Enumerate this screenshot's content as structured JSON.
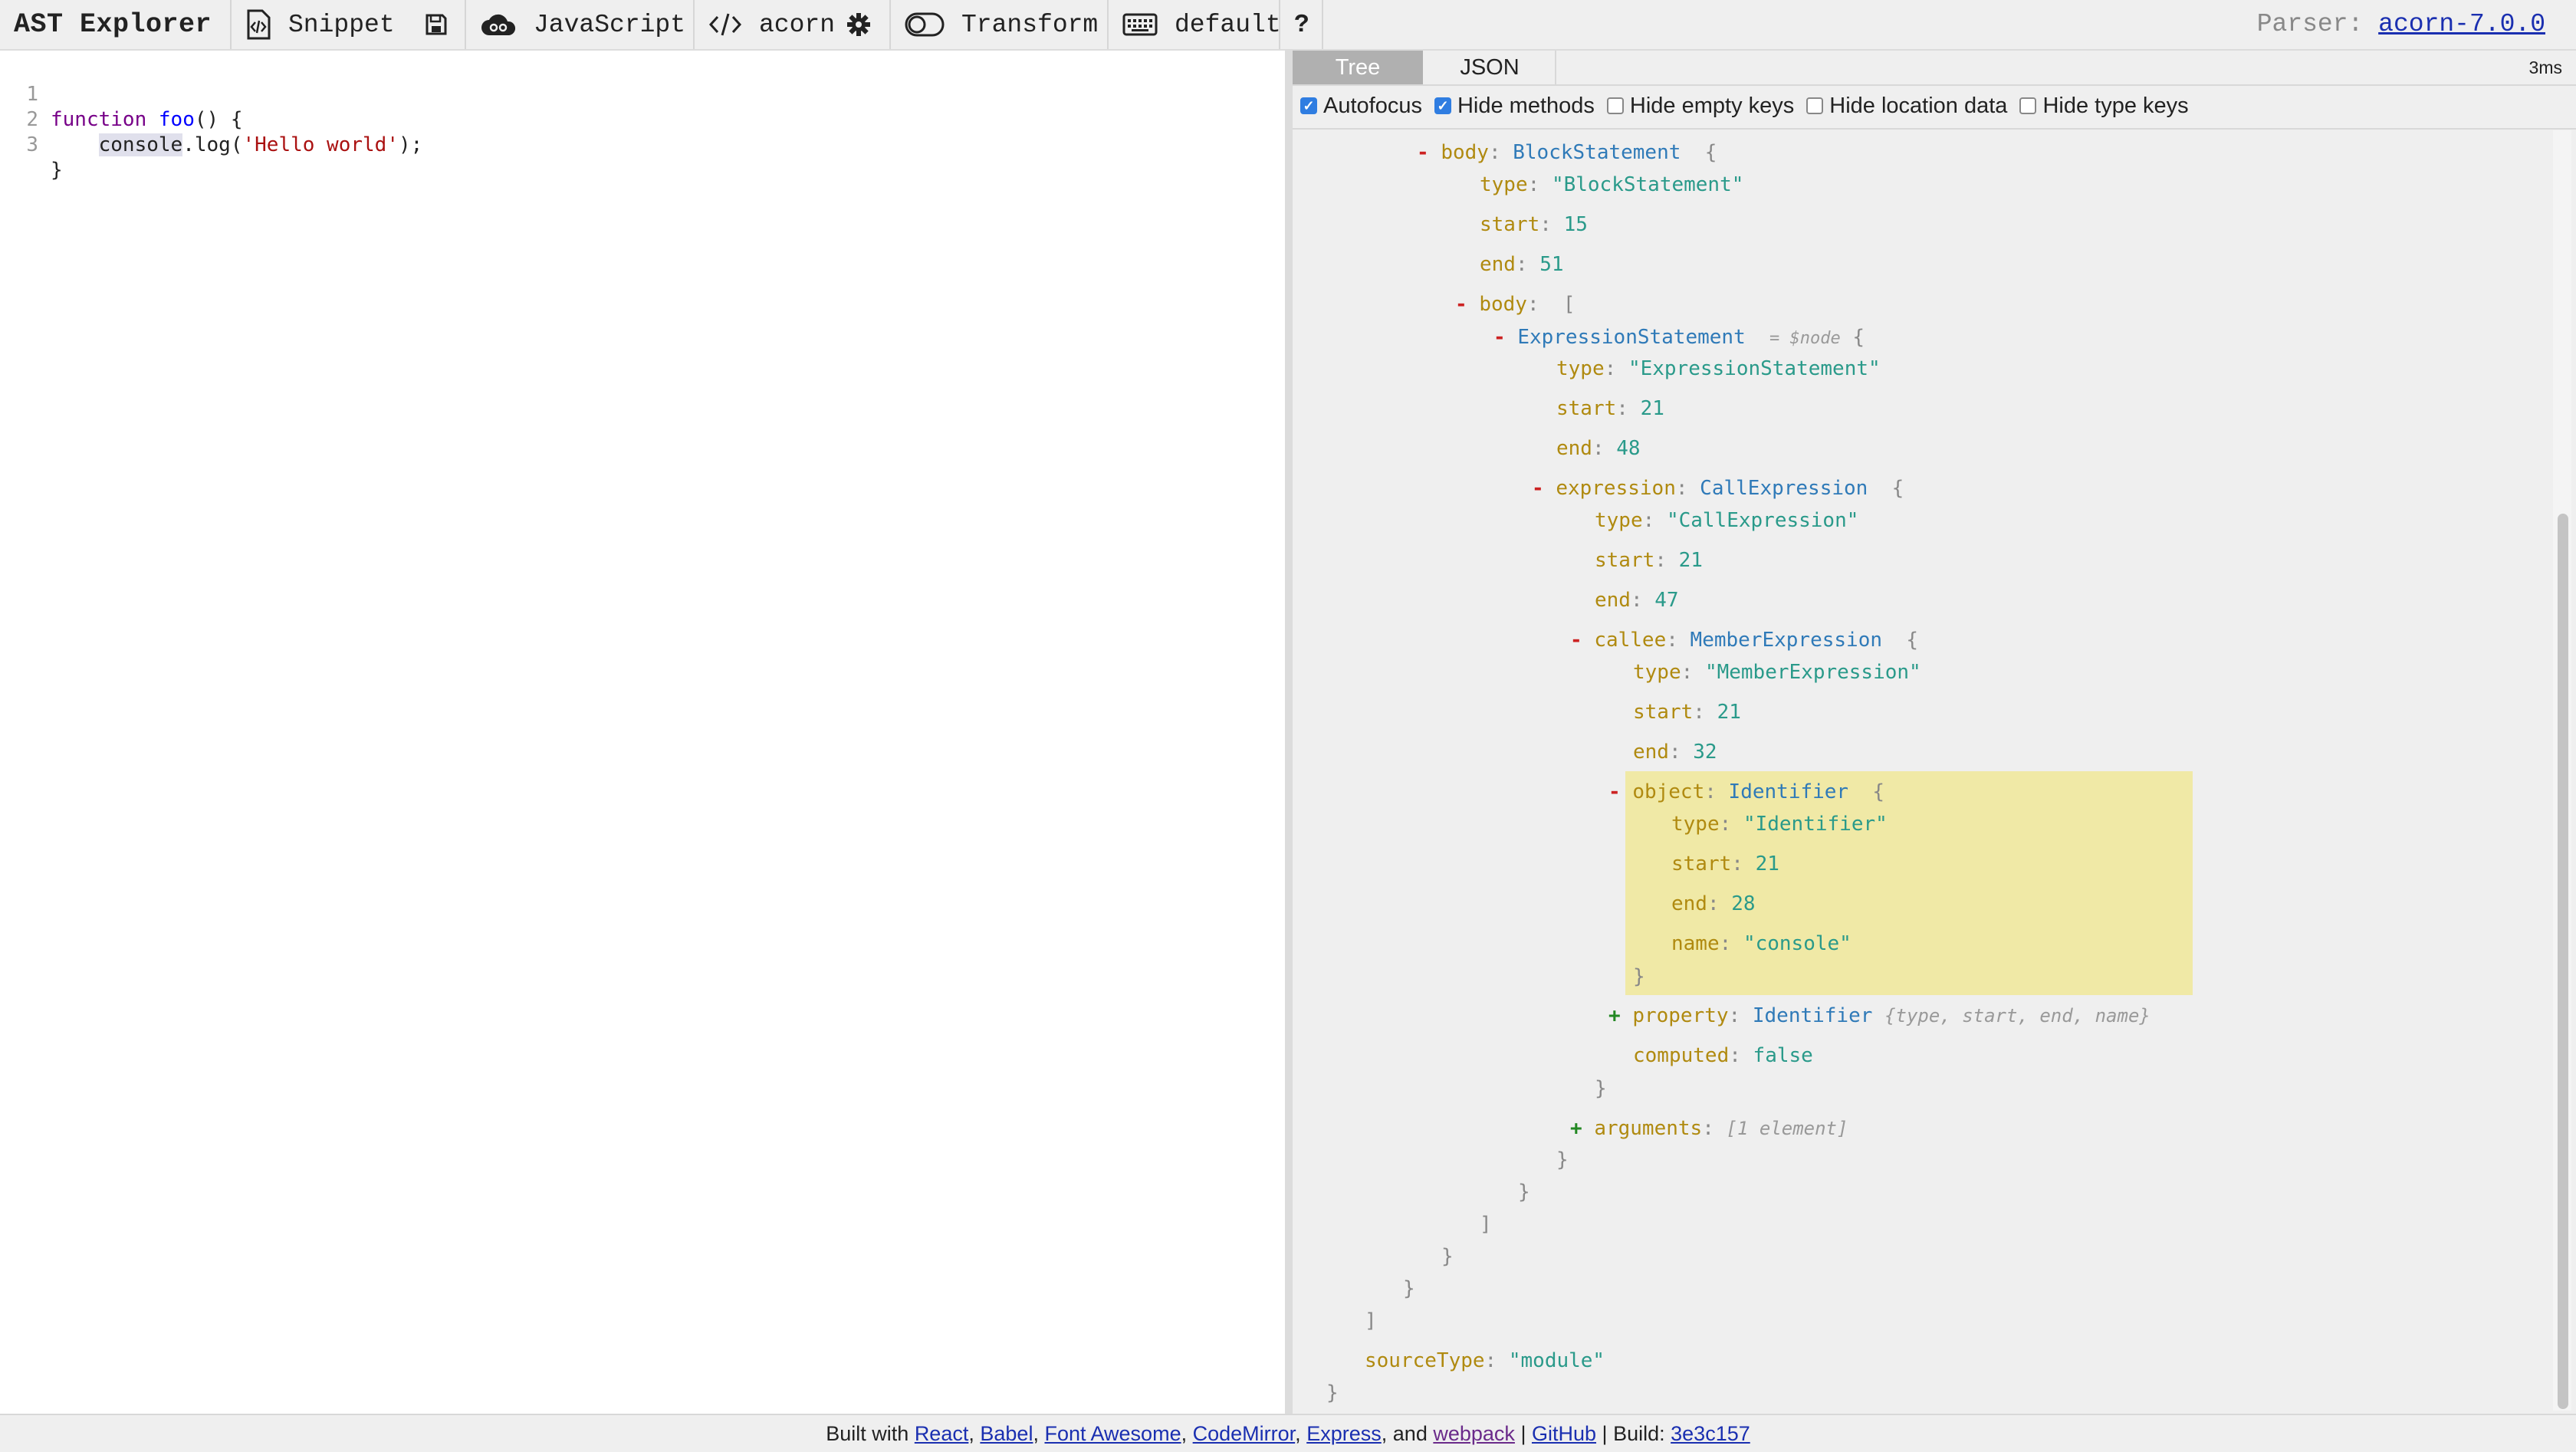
{
  "toolbar": {
    "brand": "AST Explorer",
    "snippet_label": "Snippet",
    "language_label": "JavaScript",
    "parser_label": "acorn",
    "transform_label": "Transform",
    "keymap_label": "default",
    "help_label": "?",
    "parser_info_prefix": "Parser:",
    "parser_version": "acorn-7.0.0",
    "icons": [
      "snippet-icon",
      "save-icon",
      "cloud-icon",
      "code-icon",
      "gear-icon",
      "toggle-icon",
      "keyboard-icon",
      "help-icon"
    ]
  },
  "editor": {
    "lines": [
      {
        "num": "1",
        "t1": "function",
        "t2": " ",
        "t3": "foo",
        "t4": "() {"
      },
      {
        "num": "2",
        "indent": "    ",
        "hl": "console",
        "rest1": ".log(",
        "str": "'Hello world'",
        "rest2": ");"
      },
      {
        "num": "3",
        "text": "}"
      }
    ]
  },
  "output": {
    "tabs": [
      "Tree",
      "JSON"
    ],
    "active_tab": "Tree",
    "time": "3ms",
    "options": [
      {
        "label": "Autofocus",
        "checked": true
      },
      {
        "label": "Hide methods",
        "checked": true
      },
      {
        "label": "Hide empty keys",
        "checked": false
      },
      {
        "label": "Hide location data",
        "checked": false
      },
      {
        "label": "Hide type keys",
        "checked": false
      }
    ]
  },
  "tree": {
    "body_key": "body",
    "block_type": "BlockStatement",
    "open_brace": "{",
    "type_key": "type",
    "block_type_str": "\"BlockStatement\"",
    "start_key": "start",
    "block_start": "15",
    "end_key": "end",
    "block_end": "51",
    "body_key2": "body",
    "open_bracket": "[",
    "expr_type": "ExpressionStatement",
    "node_note": "= $node",
    "expr_type_str": "\"ExpressionStatement\"",
    "expr_start": "21",
    "expr_end": "48",
    "expression_key": "expression",
    "call_type": "CallExpression",
    "call_type_str": "\"CallExpression\"",
    "call_start": "21",
    "call_end": "47",
    "callee_key": "callee",
    "member_type": "MemberExpression",
    "member_type_str": "\"MemberExpression\"",
    "member_start": "21",
    "member_end": "32",
    "object_key": "object",
    "ident_type": "Identifier",
    "ident_type_str": "\"Identifier\"",
    "ident_start": "21",
    "ident_end": "28",
    "name_key": "name",
    "ident_name": "\"console\"",
    "close_brace": "}",
    "property_key": "property",
    "property_type": "Identifier",
    "property_hint": "{type, start, end, name}",
    "computed_key": "computed",
    "computed_val": "false",
    "arguments_key": "arguments",
    "arguments_hint": "[1 element]",
    "close_bracket": "]",
    "sourcetype_key": "sourceType",
    "sourcetype_val": "\"module\"",
    "minus": "-",
    "plus": "+"
  },
  "footer": {
    "built_with": "Built with",
    "react": "React",
    "babel": "Babel",
    "fontawesome": "Font Awesome",
    "codemirror": "CodeMirror",
    "express": "Express",
    "and": "and",
    "webpack": "webpack",
    "github": "GitHub",
    "build_label": "Build:",
    "build_hash": "3e3c157",
    "comma": ",",
    "pipe": "|"
  }
}
